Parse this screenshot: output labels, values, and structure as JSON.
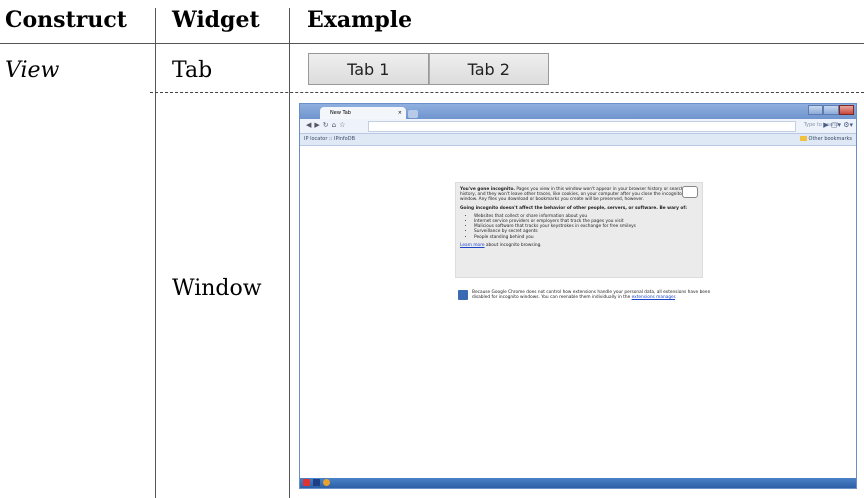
{
  "headers": {
    "construct": "Construct",
    "widget": "Widget",
    "example": "Example"
  },
  "rows": [
    {
      "construct": "View",
      "widget": "Tab"
    },
    {
      "construct": "",
      "widget": "Window"
    }
  ],
  "tab_example": {
    "tabs": [
      "Tab 1",
      "Tab 2"
    ]
  },
  "window_example": {
    "tab_title": "New Tab",
    "type_to_search": "Type to search",
    "bookmark_left": "IP locator :: IPinfoDB",
    "bookmark_right": "Other bookmarks",
    "incognito": {
      "intro_bold": "You've gone incognito.",
      "intro_text": " Pages you view in this window won't appear in your browser history or search history, and they won't leave other traces, like cookies, on your computer after you close the incognito window. Any files you download or bookmarks you create will be preserved, however.",
      "warning": "Going incognito doesn't affect the behavior of other people, servers, or software. Be wary of:",
      "items": [
        "Websites that collect or share information about you",
        "Internet service providers or employers that track the pages you visit",
        "Malicious software that tracks your keystrokes in exchange for free smileys",
        "Surveillance by secret agents",
        "People standing behind you"
      ],
      "learn_more": "Learn more",
      "learn_more_tail": " about incognito browsing."
    },
    "extensions": {
      "text": "Because Google Chrome does not control how extensions handle your personal data, all extensions have been disabled for incognito windows. You can reenable them individually in the ",
      "link": "extensions manager",
      "tail": "."
    },
    "colors": {
      "titlebar": "#7a9bd3",
      "link": "#1a44c8"
    }
  }
}
